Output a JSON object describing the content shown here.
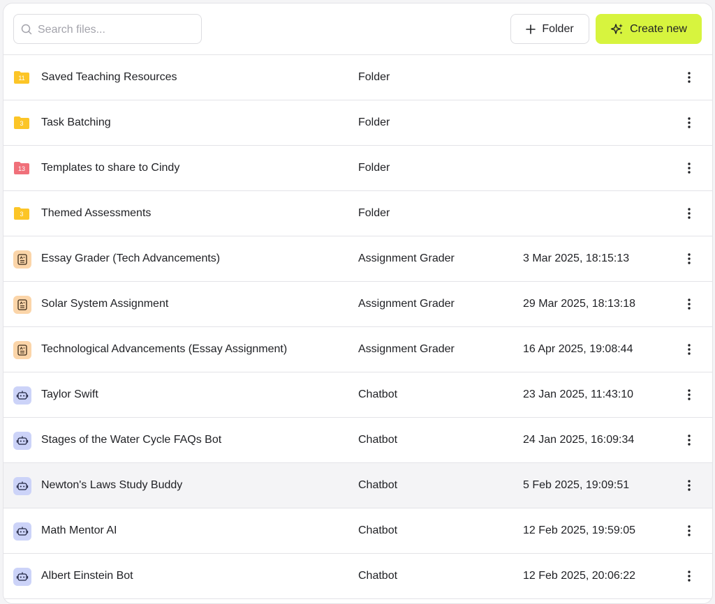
{
  "toolbar": {
    "search_placeholder": "Search files...",
    "search_value": "",
    "folder_button_label": "Folder",
    "create_button_label": "Create new",
    "accent_color": "#d7f43e"
  },
  "rows": [
    {
      "kind": "folder",
      "icon": "folder-icon",
      "icon_color": "#fcc527",
      "count": "11",
      "name": "Saved Teaching Resources",
      "type": "Folder",
      "date": ""
    },
    {
      "kind": "folder",
      "icon": "folder-icon",
      "icon_color": "#fcc527",
      "count": "3",
      "name": "Task Batching",
      "type": "Folder",
      "date": ""
    },
    {
      "kind": "folder",
      "icon": "folder-icon",
      "icon_color": "#f0707a",
      "count": "13",
      "name": "Templates to share to Cindy",
      "type": "Folder",
      "date": ""
    },
    {
      "kind": "folder",
      "icon": "folder-icon",
      "icon_color": "#fcc527",
      "count": "3",
      "name": "Themed Assessments",
      "type": "Folder",
      "date": ""
    },
    {
      "kind": "grader",
      "icon": "document-icon",
      "name": "Essay Grader (Tech Advancements)",
      "type": "Assignment Grader",
      "date": "3 Mar 2025, 18:15:13"
    },
    {
      "kind": "grader",
      "icon": "document-icon",
      "name": "Solar System Assignment",
      "type": "Assignment Grader",
      "date": "29 Mar 2025, 18:13:18"
    },
    {
      "kind": "grader",
      "icon": "document-icon",
      "name": "Technological Advancements (Essay Assignment)",
      "type": "Assignment Grader",
      "date": "16 Apr 2025, 19:08:44"
    },
    {
      "kind": "bot",
      "icon": "robot-icon",
      "name": "Taylor Swift",
      "type": "Chatbot",
      "date": "23 Jan 2025, 11:43:10"
    },
    {
      "kind": "bot",
      "icon": "robot-icon",
      "name": "Stages of the Water Cycle FAQs Bot",
      "type": "Chatbot",
      "date": "24 Jan 2025, 16:09:34"
    },
    {
      "kind": "bot",
      "icon": "robot-icon",
      "name": "Newton's Laws Study Buddy",
      "type": "Chatbot",
      "date": "5 Feb 2025, 19:09:51",
      "hovered": true
    },
    {
      "kind": "bot",
      "icon": "robot-icon",
      "name": "Math Mentor AI",
      "type": "Chatbot",
      "date": "12 Feb 2025, 19:59:05"
    },
    {
      "kind": "bot",
      "icon": "robot-icon",
      "name": "Albert Einstein Bot",
      "type": "Chatbot",
      "date": "12 Feb 2025, 20:06:22"
    }
  ]
}
